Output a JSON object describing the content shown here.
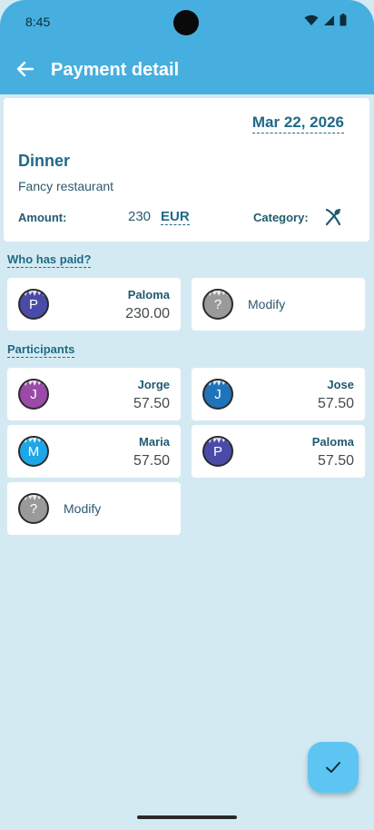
{
  "status_bar": {
    "time": "8:45"
  },
  "app_bar": {
    "title": "Payment detail",
    "back_icon": "arrow-left-icon"
  },
  "detail": {
    "date": "Mar 22, 2026",
    "title": "Dinner",
    "subtitle": "Fancy restaurant",
    "amount_label": "Amount:",
    "amount_value": "230",
    "currency": "EUR",
    "category_label": "Category:",
    "category_icon": "fork-knife-icon"
  },
  "payers_section": {
    "heading": "Who has paid?",
    "payers": [
      {
        "initial": "P",
        "name": "Paloma",
        "amount": "230.00",
        "color": "#4a4aa8"
      }
    ],
    "modify": {
      "initial": "?",
      "label": "Modify",
      "color": "#9a9a9a"
    }
  },
  "participants_section": {
    "heading": "Participants",
    "participants": [
      {
        "initial": "J",
        "name": "Jorge",
        "amount": "57.50",
        "color": "#9b4aa8"
      },
      {
        "initial": "J",
        "name": "Jose",
        "amount": "57.50",
        "color": "#1f73b8"
      },
      {
        "initial": "M",
        "name": "Maria",
        "amount": "57.50",
        "color": "#1ea7e6"
      },
      {
        "initial": "P",
        "name": "Paloma",
        "amount": "57.50",
        "color": "#4a4aa8"
      }
    ],
    "modify": {
      "initial": "?",
      "label": "Modify",
      "color": "#9a9a9a"
    }
  },
  "fab": {
    "icon": "check-icon"
  },
  "colors": {
    "app_bar": "#46afdf",
    "background": "#d4eaf3",
    "accent": "#1f6a86",
    "fab": "#5ec5f2"
  }
}
